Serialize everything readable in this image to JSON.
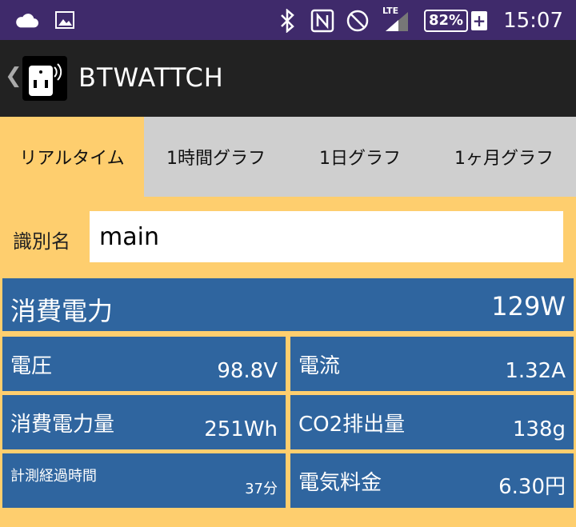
{
  "statusbar": {
    "battery": "82%",
    "network": "LTE",
    "time": "15:07"
  },
  "appbar": {
    "title": "BTWATTCH"
  },
  "tabs": [
    {
      "label": "リアルタイム",
      "active": true
    },
    {
      "label": "1時間グラフ",
      "active": false
    },
    {
      "label": "1日グラフ",
      "active": false
    },
    {
      "label": "1ヶ月グラフ",
      "active": false
    }
  ],
  "identifier": {
    "label": "識別名",
    "value": "main"
  },
  "power": {
    "label": "消費電力",
    "value": "129W"
  },
  "metrics": {
    "voltage": {
      "label": "電圧",
      "value": "98.8V"
    },
    "current": {
      "label": "電流",
      "value": "1.32A"
    },
    "energy": {
      "label": "消費電力量",
      "value": "251Wh"
    },
    "co2": {
      "label": "CO2排出量",
      "value": "138g"
    },
    "elapsed": {
      "label": "計測経過時間",
      "value": "37分"
    },
    "cost": {
      "label": "電気料金",
      "value": "6.30円"
    }
  },
  "colors": {
    "background": "#fece6e",
    "panel": "#2f659f",
    "statusbar": "#3f2a6b",
    "appbar": "#222222",
    "tab_inactive": "#cfcfcf"
  }
}
